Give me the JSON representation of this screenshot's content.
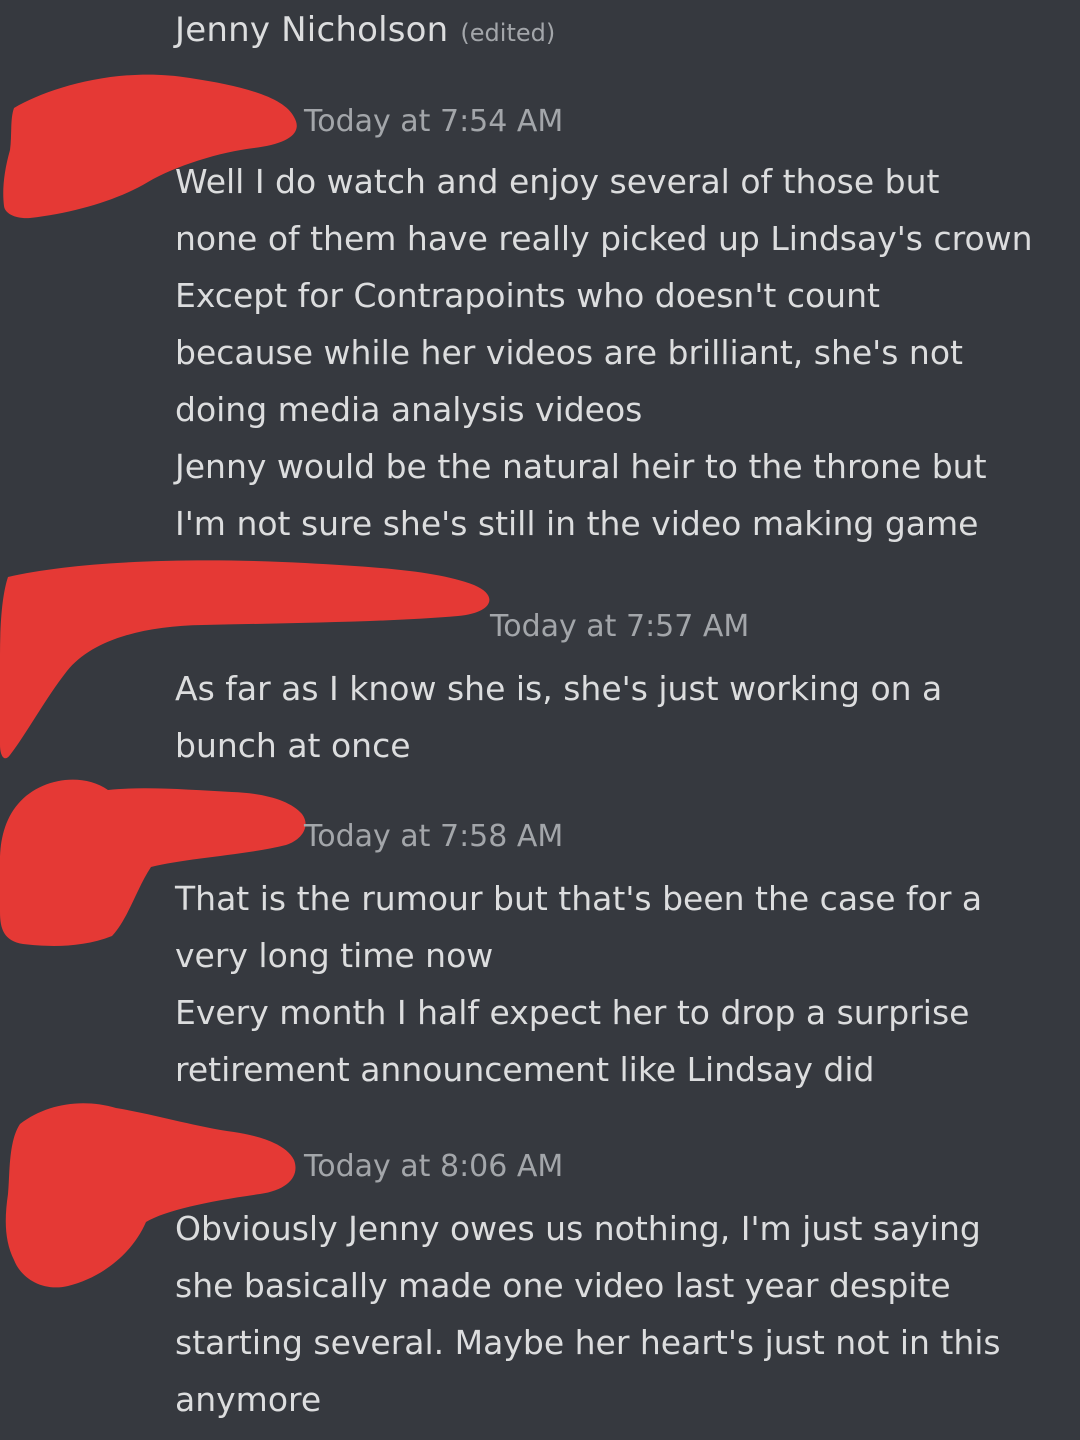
{
  "author": {
    "name": "Jenny Nicholson",
    "edited_label": "(edited)"
  },
  "messages": [
    {
      "timestamp": "Today at 7:54 AM",
      "lines": [
        "Well I do watch and enjoy several of those but",
        "none of them have really picked up Lindsay's crown",
        "Except for Contrapoints who doesn't count",
        "because while her videos are brilliant, she's not",
        "doing media analysis videos",
        "Jenny would be the natural heir to the throne but",
        "I'm not sure she's still in the video making game"
      ]
    },
    {
      "timestamp": "Today at 7:57 AM",
      "lines": [
        "As far as I know she is, she's just working on a",
        "bunch at once"
      ]
    },
    {
      "timestamp": "Today at 7:58 AM",
      "lines": [
        "That is the rumour but that's been the case for a",
        "very long time now",
        "Every month I half expect her to drop a surprise",
        "retirement announcement like Lindsay did"
      ]
    },
    {
      "timestamp": "Today at 8:06 AM",
      "lines": [
        "Obviously Jenny owes us nothing, I'm just saying",
        "she basically made one video last year despite",
        "starting several. Maybe her heart's just not in this",
        "anymore"
      ]
    }
  ],
  "colors": {
    "background": "#36393f",
    "message_text": "#dcddde",
    "timestamp_text": "#a3a6aa",
    "redaction": "#e53935"
  }
}
